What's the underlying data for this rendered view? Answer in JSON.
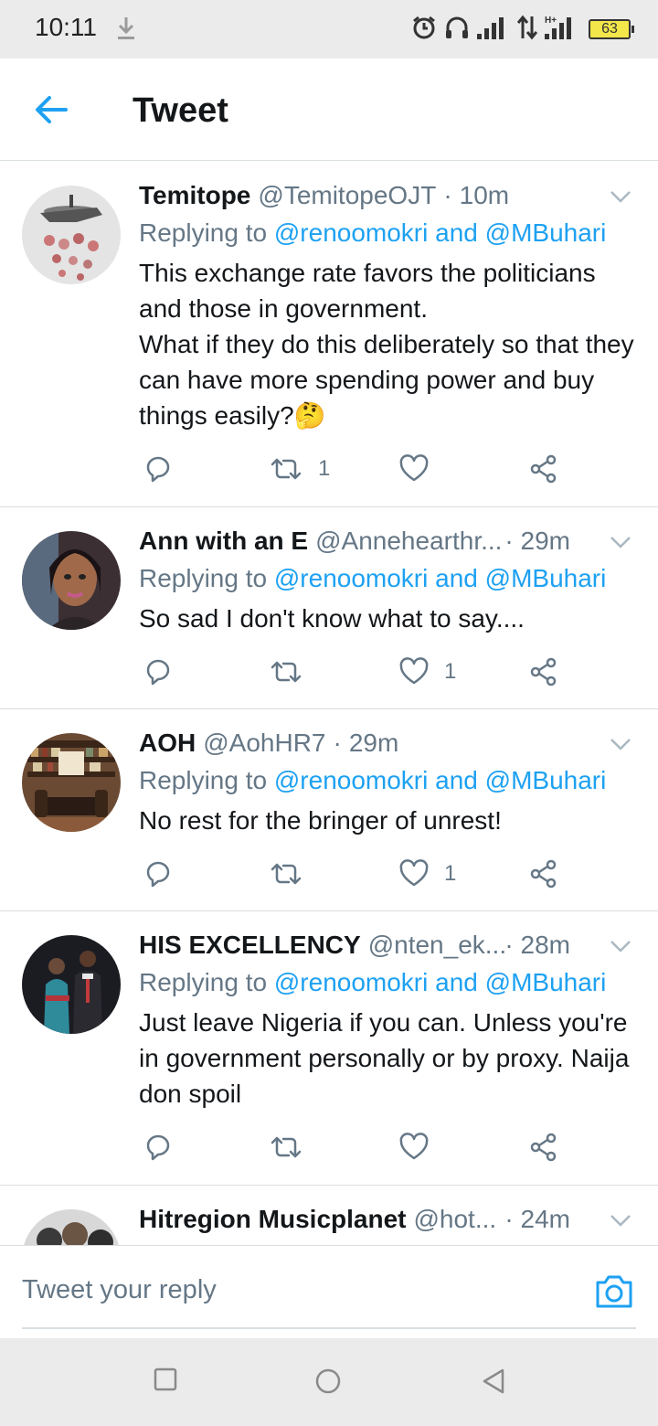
{
  "status_bar": {
    "time": "10:11",
    "battery": "63",
    "icons": [
      "download-icon",
      "alarm-icon",
      "headphones-icon",
      "signal-icon",
      "data-arrows-icon",
      "hplus-signal-icon",
      "battery-icon"
    ]
  },
  "header": {
    "back_icon": "arrow-left-icon",
    "title": "Tweet"
  },
  "tweets": [
    {
      "name": "Temitope",
      "handle": "@TemitopeOJT",
      "dot": "·",
      "time": "10m",
      "replying_prefix": "Replying to",
      "mention1": "@renoomokri",
      "and": "and",
      "mention2": "@MBuhari",
      "text": "This exchange rate favors the politicians and those in government.\nWhat if they do this deliberately so that they can have more spending power and buy things easily?🤔",
      "retweets": "1",
      "likes": ""
    },
    {
      "name": "Ann with an E",
      "handle": "@Annehearthr...",
      "dot": "·",
      "time": "29m",
      "replying_prefix": "Replying to",
      "mention1": "@renoomokri",
      "and": "and",
      "mention2": "@MBuhari",
      "text": "So sad I don't know what to say....",
      "retweets": "",
      "likes": "1"
    },
    {
      "name": "AOH",
      "handle": "@AohHR7",
      "dot": "·",
      "time": "29m",
      "replying_prefix": "Replying to",
      "mention1": "@renoomokri",
      "and": "and",
      "mention2": "@MBuhari",
      "text": "No rest for the bringer of unrest!",
      "retweets": "",
      "likes": "1"
    },
    {
      "name": "HIS EXCELLENCY",
      "handle": "@nten_ek...",
      "dot": "·",
      "time": "28m",
      "replying_prefix": "Replying to",
      "mention1": "@renoomokri",
      "and": "and",
      "mention2": "@MBuhari",
      "text": "Just leave Nigeria if you can. Unless you're in government personally or by proxy. Naija don spoil",
      "retweets": "",
      "likes": ""
    },
    {
      "name": "Hitregion Musicplanet",
      "handle": "@hot...",
      "dot": "·",
      "time": "24m"
    }
  ],
  "composer": {
    "placeholder": "Tweet your reply",
    "camera_icon": "camera-icon"
  },
  "nav_bar": {
    "icons": [
      "recents-square-icon",
      "home-circle-icon",
      "back-triangle-icon"
    ]
  },
  "colors": {
    "accent": "#1da1f2",
    "secondary_text": "#657786",
    "primary_text": "#14171a",
    "divider": "#d9dee2",
    "system_bar": "#ebebeb"
  }
}
